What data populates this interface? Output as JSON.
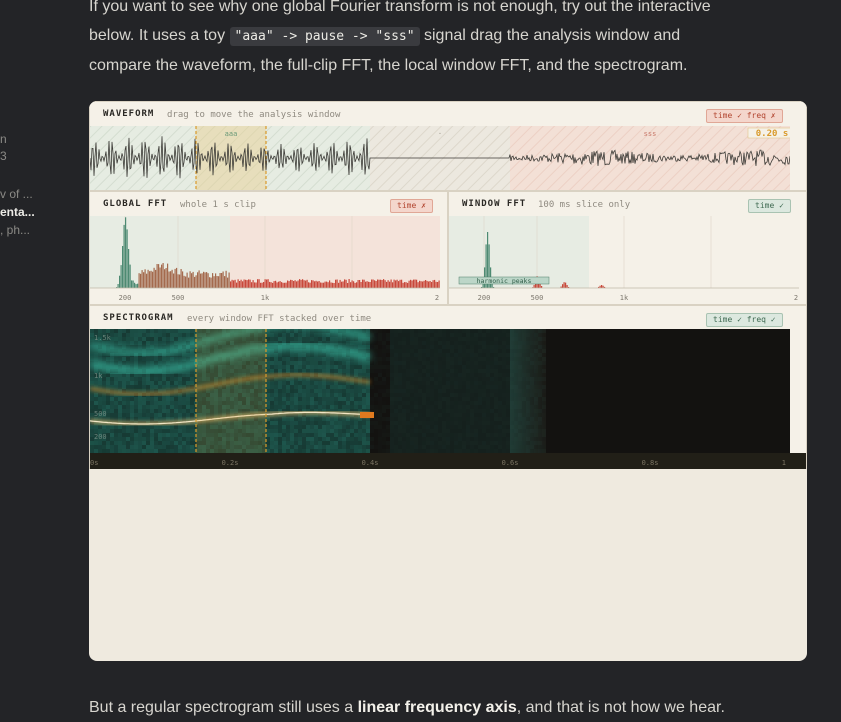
{
  "sidebar": {
    "items": [
      {
        "label": "n"
      },
      {
        "label": "3"
      },
      {
        "label": "v of ..."
      },
      {
        "label": "enta..."
      },
      {
        "label": ", ph..."
      }
    ]
  },
  "intro": {
    "p1": "If you want to see why one global Fourier transform is not enough, try out the interactive",
    "p2a": "below. It uses a toy ",
    "code": "\"aaa\" -> pause -> \"sss\"",
    "p2b": " signal drag the analysis window and",
    "p3": "compare the waveform, the full-clip FFT, the local window FFT, and the spectrogram."
  },
  "waveform": {
    "title": "WAVEFORM",
    "subtitle": "drag to move the analysis window",
    "tag": "time ✓  freq ✗",
    "label_aaa": "aaa",
    "label_dot": "·",
    "label_sss": "sss",
    "time_readout": "0.20 s"
  },
  "global_fft": {
    "title": "GLOBAL FFT",
    "subtitle": "whole 1 s clip",
    "tag": "time ✗",
    "ticks": [
      "200",
      "500",
      "1k",
      "2"
    ]
  },
  "window_fft": {
    "title": "WINDOW FFT",
    "subtitle": "100 ms slice only",
    "tag": "time ✓",
    "ticks": [
      "200",
      "500",
      "1k",
      "2"
    ],
    "annotation": "harmonic peaks"
  },
  "spectrogram": {
    "title": "SPECTROGRAM",
    "subtitle": "every window FFT stacked over time",
    "tag": "time ✓  freq ✓",
    "yticks": [
      "1.5k",
      "1k",
      "500",
      "200"
    ],
    "xticks": [
      "0s",
      "0.2s",
      "0.4s",
      "0.6s",
      "0.8s",
      "1"
    ]
  },
  "outro": {
    "a": "But a regular spectrogram still uses a ",
    "b": "linear frequency axis",
    "c": ", and that is not how we hear."
  },
  "colors": {
    "accent": "#d99a2b",
    "vowel": "#3d8a75",
    "fricative": "#c8483a",
    "spec_bg": "#131210"
  }
}
